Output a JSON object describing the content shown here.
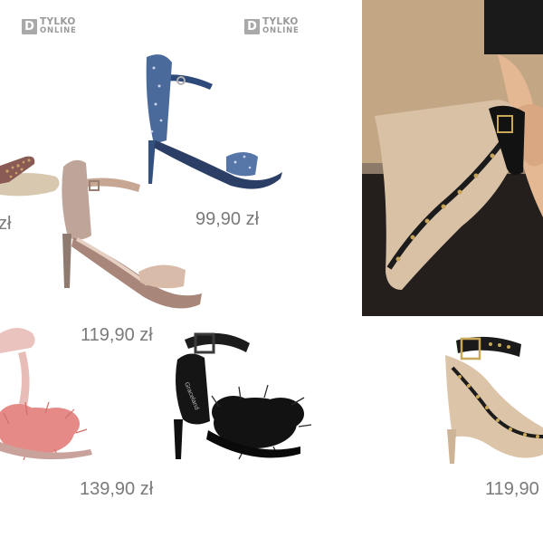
{
  "badges": [
    {
      "line1": "TYLKO",
      "line2": "ONLINE",
      "letter": "D"
    },
    {
      "line1": "TYLKO",
      "line2": "ONLINE",
      "letter": "D"
    }
  ],
  "products": {
    "glitter_rose": {
      "price": "zł",
      "icon": "glitter-sandal-icon"
    },
    "blue_glitter": {
      "price": "99,90 zł",
      "icon": "blue-glitter-sandal-icon"
    },
    "rose_gold": {
      "price": "119,90 zł",
      "icon": "rose-gold-sandal-icon"
    },
    "pink_feather": {
      "price": "139,90 zł",
      "icon": "pink-feather-sandal-icon"
    },
    "black_feather": {
      "price": "",
      "icon": "black-feather-sandal-icon",
      "brand_print": "Graceland"
    },
    "nude_studded": {
      "price": "119,90",
      "icon": "nude-studded-pump-icon"
    }
  },
  "colors": {
    "price_text": "#7a7a7a",
    "badge_gray": "#a9a9a9",
    "photo_wall": "#b79a78",
    "photo_dark": "#1e1e1e"
  }
}
